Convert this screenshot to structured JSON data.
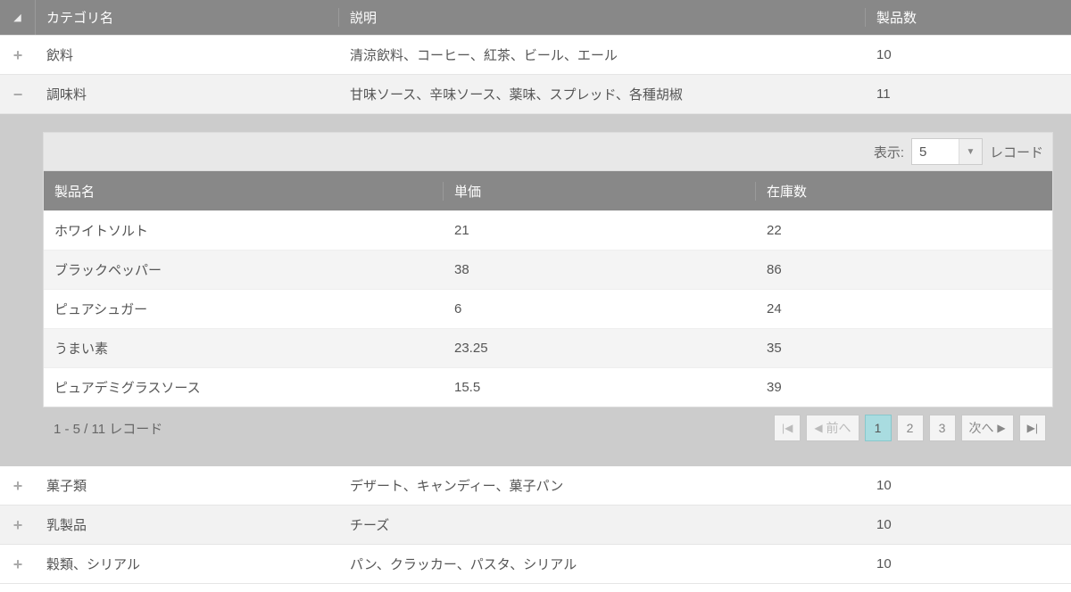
{
  "columns": {
    "category": "カテゴリ名",
    "description": "説明",
    "count": "製品数"
  },
  "rows": [
    {
      "expanded": false,
      "name": "飲料",
      "desc": "清涼飲料、コーヒー、紅茶、ビール、エール",
      "count": "10"
    },
    {
      "expanded": true,
      "name": "調味料",
      "desc": "甘味ソース、辛味ソース、薬味、スプレッド、各種胡椒",
      "count": "11"
    },
    {
      "expanded": false,
      "name": "菓子類",
      "desc": "デザート、キャンディー、菓子パン",
      "count": "10"
    },
    {
      "expanded": false,
      "name": "乳製品",
      "desc": "チーズ",
      "count": "10"
    },
    {
      "expanded": false,
      "name": "穀類、シリアル",
      "desc": "パン、クラッカー、パスタ、シリアル",
      "count": "10"
    }
  ],
  "child": {
    "toolbar": {
      "show_label": "表示:",
      "page_size": "5",
      "records_label": "レコード"
    },
    "columns": {
      "name": "製品名",
      "price": "単価",
      "stock": "在庫数"
    },
    "rows": [
      {
        "name": "ホワイトソルト",
        "price": "21",
        "stock": "22"
      },
      {
        "name": "ブラックペッパー",
        "price": "38",
        "stock": "86"
      },
      {
        "name": "ピュアシュガー",
        "price": "6",
        "stock": "24"
      },
      {
        "name": "うまい素",
        "price": "23.25",
        "stock": "35"
      },
      {
        "name": "ピュアデミグラスソース",
        "price": "15.5",
        "stock": "39"
      }
    ],
    "footer": {
      "status": "1 - 5 / 11 レコード",
      "prev": "前へ",
      "next": "次へ",
      "pages": [
        "1",
        "2",
        "3"
      ],
      "active_page": "1"
    }
  }
}
